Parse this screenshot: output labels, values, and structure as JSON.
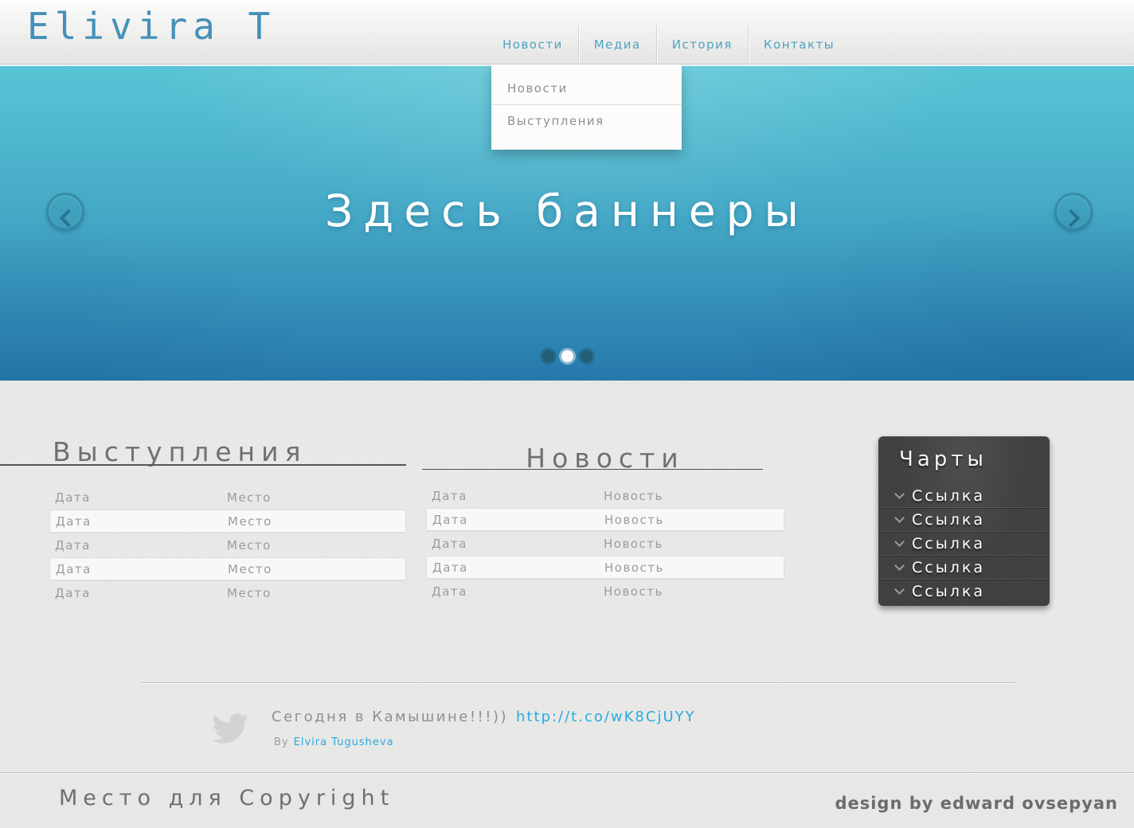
{
  "meta": {
    "title": "Elivira T"
  },
  "colors": {
    "logo_blue": "#4590b7",
    "nav_blue": "#4fa3c2",
    "link_blue": "#29abe2",
    "banner_top": "#58c4d5",
    "banner_bottom": "#2679ac",
    "charts_bg": "#454545",
    "heading_gray": "#707070",
    "table_text_gray": "#9c9c9c",
    "page_bg": "#e9e9e7"
  },
  "header": {
    "logo": "Elivira T",
    "nav": [
      {
        "label": "Новости"
      },
      {
        "label": "Медиа"
      },
      {
        "label": "История"
      },
      {
        "label": "Контакты"
      }
    ],
    "dropdown": {
      "items": [
        "Новости",
        "Выступления"
      ]
    }
  },
  "banner": {
    "title": "Здесь баннеры",
    "dots": [
      {
        "active": false
      },
      {
        "active": true
      },
      {
        "active": false
      }
    ]
  },
  "performances": {
    "title": "Выступления",
    "rows": [
      [
        "Дата",
        "Место"
      ],
      [
        "Дата",
        "Место"
      ],
      [
        "Дата",
        "Место"
      ],
      [
        "Дата",
        "Место"
      ],
      [
        "Дата",
        "Место"
      ]
    ]
  },
  "news": {
    "title": "Новости",
    "rows": [
      [
        "Дата",
        "Новость"
      ],
      [
        "Дата",
        "Новость"
      ],
      [
        "Дата",
        "Новость"
      ],
      [
        "Дата",
        "Новость"
      ],
      [
        "Дата",
        "Новость"
      ]
    ]
  },
  "charts": {
    "title": "Чарты",
    "links": [
      "Ссылка",
      "Ссылка",
      "Ссылка",
      "Ссылка",
      "Ссылка"
    ]
  },
  "tweet": {
    "icon": "twitter-bird",
    "text": "Сегодня в Камышине!!!))",
    "link": "http://t.co/wK8CjUYY",
    "by_label": "By",
    "author": "Elvira Tugusheva"
  },
  "footer": {
    "copyright": "Место для Copyright",
    "credit": "design by edward ovsepyan"
  }
}
